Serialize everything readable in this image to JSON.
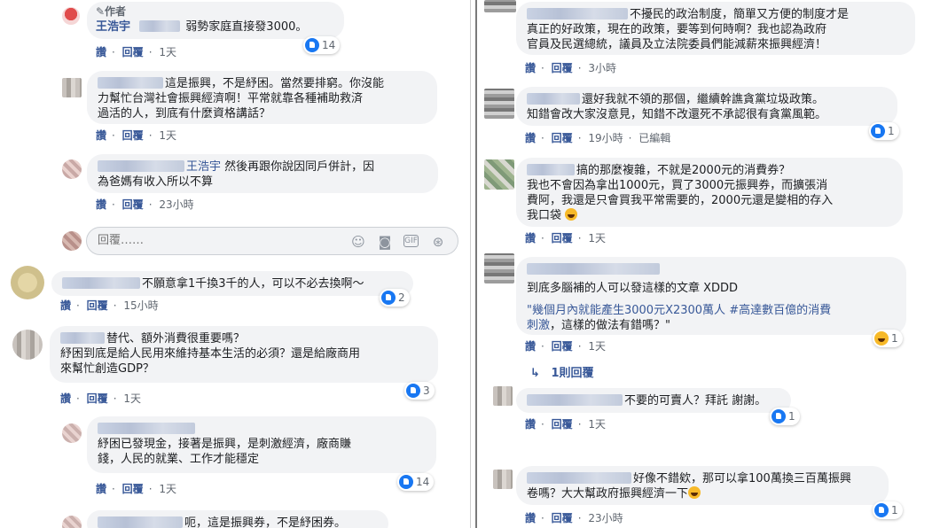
{
  "reply_box": {
    "placeholder": "回覆……"
  },
  "left": {
    "comments": [
      {
        "author_badge": "✎作者",
        "author": "王浩宇",
        "text": "弱勢家庭直接發3000。",
        "like": "讚",
        "reply": "回覆",
        "time": "1天",
        "reactions": "14"
      },
      {
        "text_line1": "這是振興，不是紓困。當然要排窮。你沒能",
        "text_rest": "力幫忙台灣社會振興經濟啊！平常就靠各種補助救済\n過活的人，到底有什麼資格講話？",
        "like": "讚",
        "reply": "回覆",
        "time": "1天"
      },
      {
        "tag": "王浩宇",
        "text_line1": "然後再跟你說因同戶併計，因",
        "text_rest": "為爸媽有收入所以不算",
        "like": "讚",
        "reply": "回覆",
        "time": "23小時"
      },
      {
        "text": "不願意拿1千換3千的人，可以不必去換啊～",
        "like": "讚",
        "reply": "回覆",
        "time": "15小時",
        "reactions": "2"
      },
      {
        "text_line1": "替代、額外消費很重要嗎？",
        "text_rest": "紓困到底是給人民用來維持基本生活的必須？還是給廠商用\n來幫忙創造GDP？",
        "like": "讚",
        "reply": "回覆",
        "time": "1天",
        "reactions": "3"
      },
      {
        "text": "紓困已發現金，接著是振興，是刺激經濟，廠商賺\n錢，人民的就業、工作才能穩定",
        "like": "讚",
        "reply": "回覆",
        "time": "1天",
        "reactions": "14"
      },
      {
        "text": "呃，這是振興券，不是紓困券。"
      }
    ]
  },
  "right": {
    "comments": [
      {
        "text_line1": "不擾民的政治制度，簡單又方便的制度才是",
        "text_rest": "真正的好政策，現在的政策，要等到何時啊？我也認為政府\n官員及民選總統，議員及立法院委員們能減薪來振興經濟！",
        "like": "讚",
        "reply": "回覆",
        "time": "3小時"
      },
      {
        "text_line1": "還好我就不領的那個，繼續幹譙貪黨垃圾政策。",
        "text_rest": "知錯會改大家沒意見，知錯不改還死不承認很有貪黨風範。",
        "like": "讚",
        "reply": "回覆",
        "time": "19小時",
        "edited": "已編輯",
        "reactions": "1"
      },
      {
        "text_line1": "搞的那麼複雜，不就是2000元的消費券？",
        "text_rest": "我也不會因為拿出1000元，買了3000元振興券，而擴張消\n費阿，我還是只會買我平常需要的，2000元還是變相的存入\n我口袋",
        "like": "讚",
        "reply": "回覆",
        "time": "1天"
      },
      {
        "text": "到底多腦補的人可以發這樣的文章 XDDD",
        "quote": "\"幾個月內就能產生3000元X2300萬人",
        "hashtag": "#高達數百億的消費",
        "quote2": "刺激",
        "quote3": "，這樣的做法有錯嗎？\"",
        "like": "讚",
        "reply": "回覆",
        "time": "1天",
        "reactions": "1",
        "replies_link": "1則回覆"
      },
      {
        "text": "不要的可賣人？拜託 謝謝。",
        "like": "讚",
        "reply": "回覆",
        "time": "1天",
        "reactions": "1"
      },
      {
        "text_line1": "好像不錯欸，那可以拿100萬換三百萬振興",
        "text_rest": "卷嗎？大大幫政府振興經濟一下",
        "like": "讚",
        "reply": "回覆",
        "time": "23小時",
        "reactions": "1"
      }
    ]
  }
}
